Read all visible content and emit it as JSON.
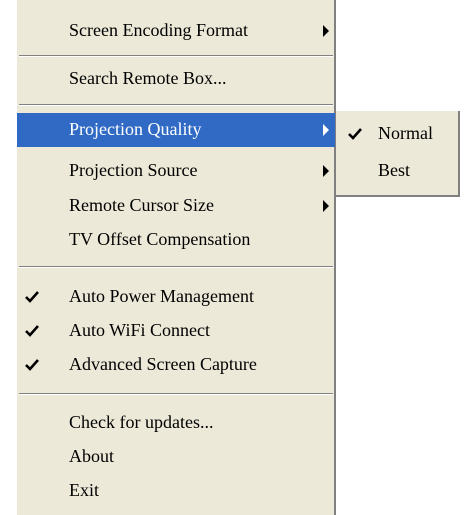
{
  "menu": {
    "items": [
      {
        "label": "Screen Encoding Format",
        "has_submenu": true
      },
      {
        "label": "Search Remote Box..."
      },
      {
        "label": "Projection Quality",
        "has_submenu": true,
        "highlighted": true
      },
      {
        "label": "Projection Source",
        "has_submenu": true
      },
      {
        "label": "Remote Cursor Size",
        "has_submenu": true
      },
      {
        "label": "TV Offset Compensation"
      },
      {
        "label": "Auto Power Management",
        "checked": true
      },
      {
        "label": "Auto WiFi Connect",
        "checked": true
      },
      {
        "label": "Advanced Screen Capture",
        "checked": true
      },
      {
        "label": "Check for updates..."
      },
      {
        "label": "About"
      },
      {
        "label": "Exit"
      }
    ]
  },
  "submenu": {
    "items": [
      {
        "label": "Normal",
        "checked": true
      },
      {
        "label": "Best"
      }
    ]
  },
  "colors": {
    "menu_background": "#ece9d8",
    "highlight": "#316ac5"
  }
}
